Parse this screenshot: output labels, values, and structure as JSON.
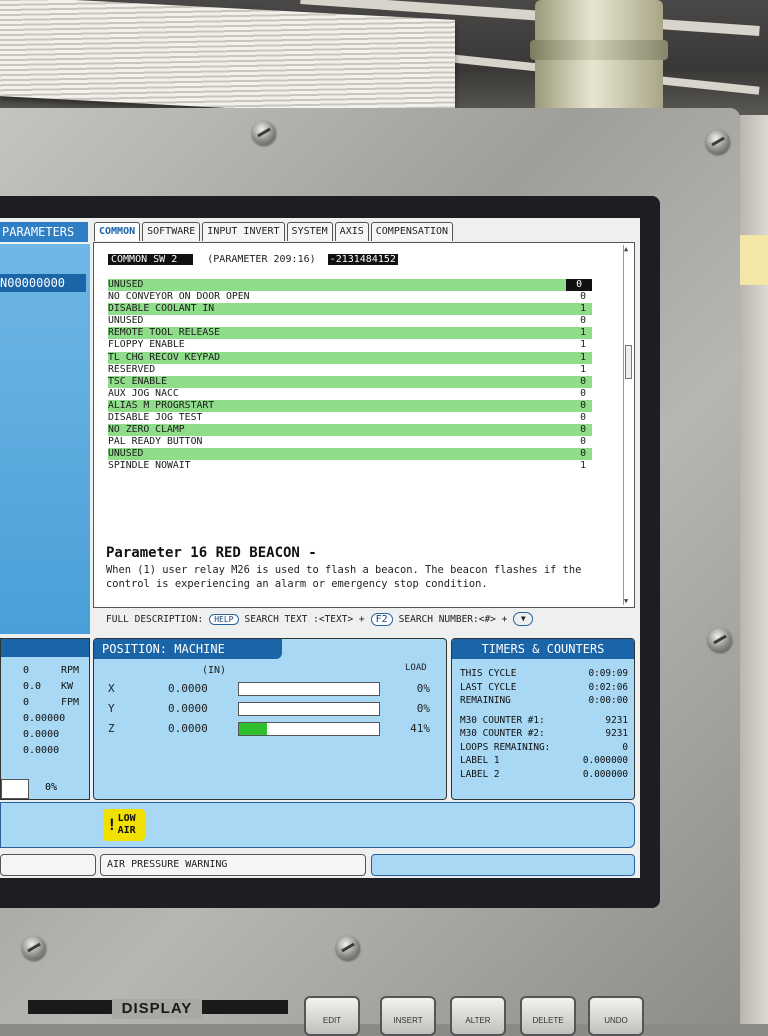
{
  "left_panel": {
    "tab_label": "PARAMETERS",
    "n_label": "N00000000",
    "readouts": [
      {
        "value": "0",
        "unit": "RPM"
      },
      {
        "value": "0.0",
        "unit": "KW"
      },
      {
        "value": "0",
        "unit": "FPM"
      },
      {
        "value": "0.00000",
        "unit": ""
      },
      {
        "value": "0.0000",
        "unit": ""
      },
      {
        "value": "0.0000",
        "unit": ""
      }
    ],
    "bar_percent": "0%"
  },
  "tabs": [
    {
      "label": "COMMON",
      "active": true
    },
    {
      "label": "SOFTWARE",
      "active": false
    },
    {
      "label": "INPUT INVERT",
      "active": false
    },
    {
      "label": "SYSTEM",
      "active": false
    },
    {
      "label": "AXIS",
      "active": false
    },
    {
      "label": "COMPENSATION",
      "active": false
    }
  ],
  "parameter": {
    "name": "COMMON SW 2",
    "number": "(PARAMETER  209:16)",
    "value": "-2131484152",
    "bits": [
      {
        "label": "UNUSED",
        "value": "0",
        "highlight": true,
        "selected": true
      },
      {
        "label": "NO CONVEYOR ON DOOR OPEN",
        "value": "0",
        "highlight": false
      },
      {
        "label": "DISABLE COOLANT IN",
        "value": "1",
        "highlight": true
      },
      {
        "label": "UNUSED",
        "value": "0",
        "highlight": false
      },
      {
        "label": "REMOTE TOOL RELEASE",
        "value": "1",
        "highlight": true
      },
      {
        "label": "FLOPPY ENABLE",
        "value": "1",
        "highlight": false
      },
      {
        "label": "TL CHG RECOV KEYPAD",
        "value": "1",
        "highlight": true
      },
      {
        "label": "RESERVED",
        "value": "1",
        "highlight": false
      },
      {
        "label": "TSC ENABLE",
        "value": "0",
        "highlight": true
      },
      {
        "label": "AUX JOG NACC",
        "value": "0",
        "highlight": false
      },
      {
        "label": "ALIAS M PROGRSTART",
        "value": "0",
        "highlight": true
      },
      {
        "label": "DISABLE JOG TEST",
        "value": "0",
        "highlight": false
      },
      {
        "label": "NO ZERO CLAMP",
        "value": "0",
        "highlight": true
      },
      {
        "label": "PAL READY BUTTON",
        "value": "0",
        "highlight": false
      },
      {
        "label": "UNUSED",
        "value": "0",
        "highlight": true
      },
      {
        "label": "SPINDLE NOWAIT",
        "value": "1",
        "highlight": false
      }
    ],
    "desc_title": "Parameter 16 RED BEACON -",
    "desc_text": "When (1) user relay M26 is used to flash a beacon. The beacon flashes if the control is experiencing an alarm or emergency stop condition."
  },
  "help_bar": {
    "full_desc": "FULL DESCRIPTION:",
    "help_key": "HELP",
    "search_text": "SEARCH TEXT :<TEXT> +",
    "f2_key": "F2",
    "search_number": "SEARCH NUMBER:<#> +",
    "down_key": "▼"
  },
  "position": {
    "title": "POSITION: MACHINE",
    "unit": "(IN)",
    "load_label": "LOAD",
    "axes": [
      {
        "axis": "X",
        "value": "0.0000",
        "load": 0,
        "load_label": "0%"
      },
      {
        "axis": "Y",
        "value": "0.0000",
        "load": 0,
        "load_label": "0%"
      },
      {
        "axis": "Z",
        "value": "0.0000",
        "load": 0.2,
        "load_label": "41%"
      }
    ]
  },
  "timers": {
    "title": "TIMERS & COUNTERS",
    "rows_a": [
      {
        "label": "THIS CYCLE",
        "value": "0:09:09"
      },
      {
        "label": "LAST CYCLE",
        "value": "0:02:06"
      },
      {
        "label": "REMAINING",
        "value": "0:00:00"
      }
    ],
    "rows_b": [
      {
        "label": "M30 COUNTER #1:",
        "value": "9231"
      },
      {
        "label": "M30 COUNTER #2:",
        "value": "9231"
      },
      {
        "label": "LOOPS REMAINING:",
        "value": "0"
      },
      {
        "label": "LABEL 1",
        "value": "0.000000"
      },
      {
        "label": "LABEL 2",
        "value": "0.000000"
      }
    ]
  },
  "alerts": {
    "low_air_line1": "LOW",
    "low_air_line2": "AIR",
    "message": "AIR PRESSURE WARNING"
  },
  "hardware": {
    "display_label": "DISPLAY",
    "keys": [
      "EDIT",
      "INSERT",
      "ALTER",
      "DELETE",
      "UNDO"
    ]
  },
  "colors": {
    "accent_blue": "#1a64a8",
    "panel_blue": "#a8d8f4",
    "highlight_green": "#8fdc8a",
    "warning_yellow": "#f2e000"
  }
}
